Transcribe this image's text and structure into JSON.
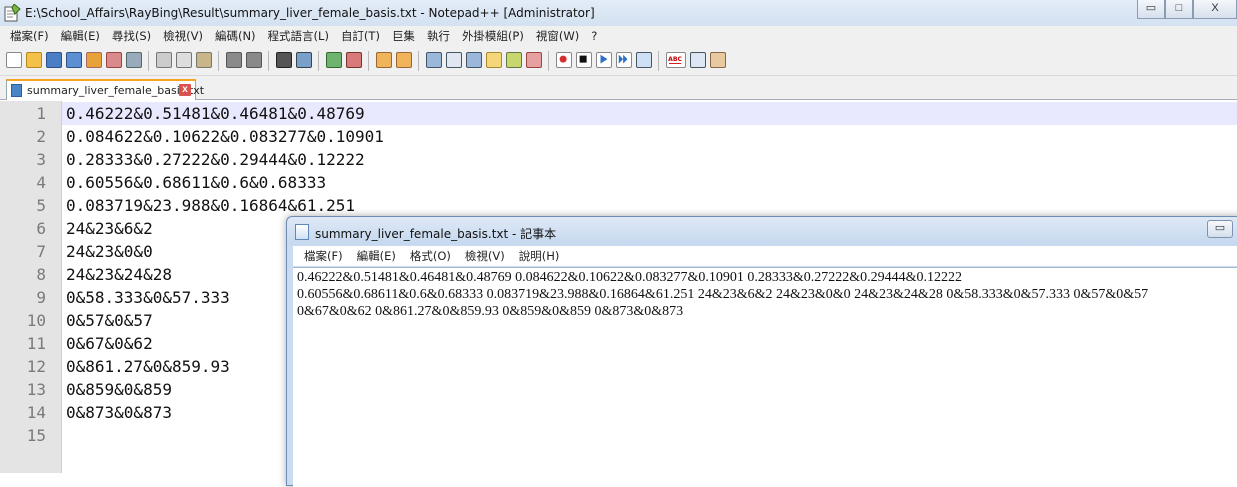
{
  "npp": {
    "title": "E:\\School_Affairs\\RayBing\\Result\\summary_liver_female_basis.txt - Notepad++ [Administrator]",
    "menu": [
      "檔案(F)",
      "編輯(E)",
      "尋找(S)",
      "檢視(V)",
      "編碼(N)",
      "程式語言(L)",
      "自訂(T)",
      "巨集",
      "執行",
      "外掛模組(P)",
      "視窗(W)",
      "?"
    ],
    "tab_label": "summary_liver_female_basis.txt",
    "tab_close": "x",
    "line_numbers": [
      "1",
      "2",
      "3",
      "4",
      "5",
      "6",
      "7",
      "8",
      "9",
      "10",
      "11",
      "12",
      "13",
      "14",
      "15"
    ],
    "lines": [
      "0.46222&0.51481&0.46481&0.48769",
      "0.084622&0.10622&0.083277&0.10901",
      "0.28333&0.27222&0.29444&0.12222",
      "0.60556&0.68611&0.6&0.68333",
      "0.083719&23.988&0.16864&61.251",
      "24&23&6&2",
      "24&23&0&0",
      "24&23&24&28",
      "0&58.333&0&57.333",
      "0&57&0&57",
      "0&67&0&62",
      "0&861.27&0&859.93",
      "0&859&0&859",
      "0&873&0&873",
      ""
    ],
    "win_min": "▭",
    "win_max": "□",
    "win_close": "X"
  },
  "notepad": {
    "title": "summary_liver_female_basis.txt - 記事本",
    "menu": [
      "檔案(F)",
      "編輯(E)",
      "格式(O)",
      "檢視(V)",
      "說明(H)"
    ],
    "min_button": "▭",
    "lines": [
      "0.46222&0.51481&0.46481&0.48769 0.084622&0.10622&0.083277&0.10901 0.28333&0.27222&0.29444&0.12222",
      "0.60556&0.68611&0.6&0.68333 0.083719&23.988&0.16864&61.251 24&23&6&2 24&23&0&0 24&23&24&28 0&58.333&0&57.333 0&57&0&57",
      "0&67&0&62 0&861.27&0&859.93 0&859&0&859 0&873&0&873"
    ]
  },
  "colors": {
    "current_line": "#e8e8ff",
    "gutter": "#e4e4e4",
    "tab_accent": "#f5a623"
  }
}
